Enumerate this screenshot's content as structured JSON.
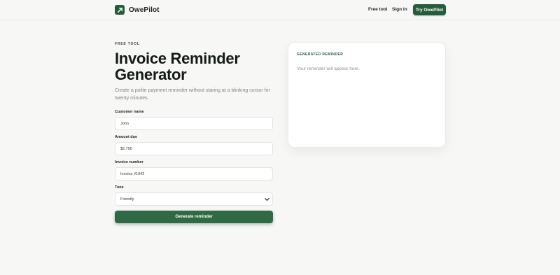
{
  "brand": {
    "name": "OwePilot",
    "accent": "#245c3c"
  },
  "nav": {
    "free_tool": "Free tool",
    "sign_in": "Sign in",
    "cta": "Try OwePilot"
  },
  "hero": {
    "eyebrow": "FREE TOOL",
    "title_line1": "Invoice Reminder",
    "title_line2": "Generator",
    "subtitle": "Create a polite payment reminder without staring at a blinking cursor for twenty minutes."
  },
  "form": {
    "customer_name": {
      "label": "Customer name",
      "value": "John"
    },
    "amount_due": {
      "label": "Amount due",
      "value": "$2,750"
    },
    "invoice_number": {
      "label": "Invoice number",
      "value": "Invoice #1042"
    },
    "tone": {
      "label": "Tone",
      "value": "Friendly"
    },
    "submit_label": "Generate reminder"
  },
  "output": {
    "title": "GENERATED REMINDER",
    "placeholder": "Your reminder will appear here."
  }
}
